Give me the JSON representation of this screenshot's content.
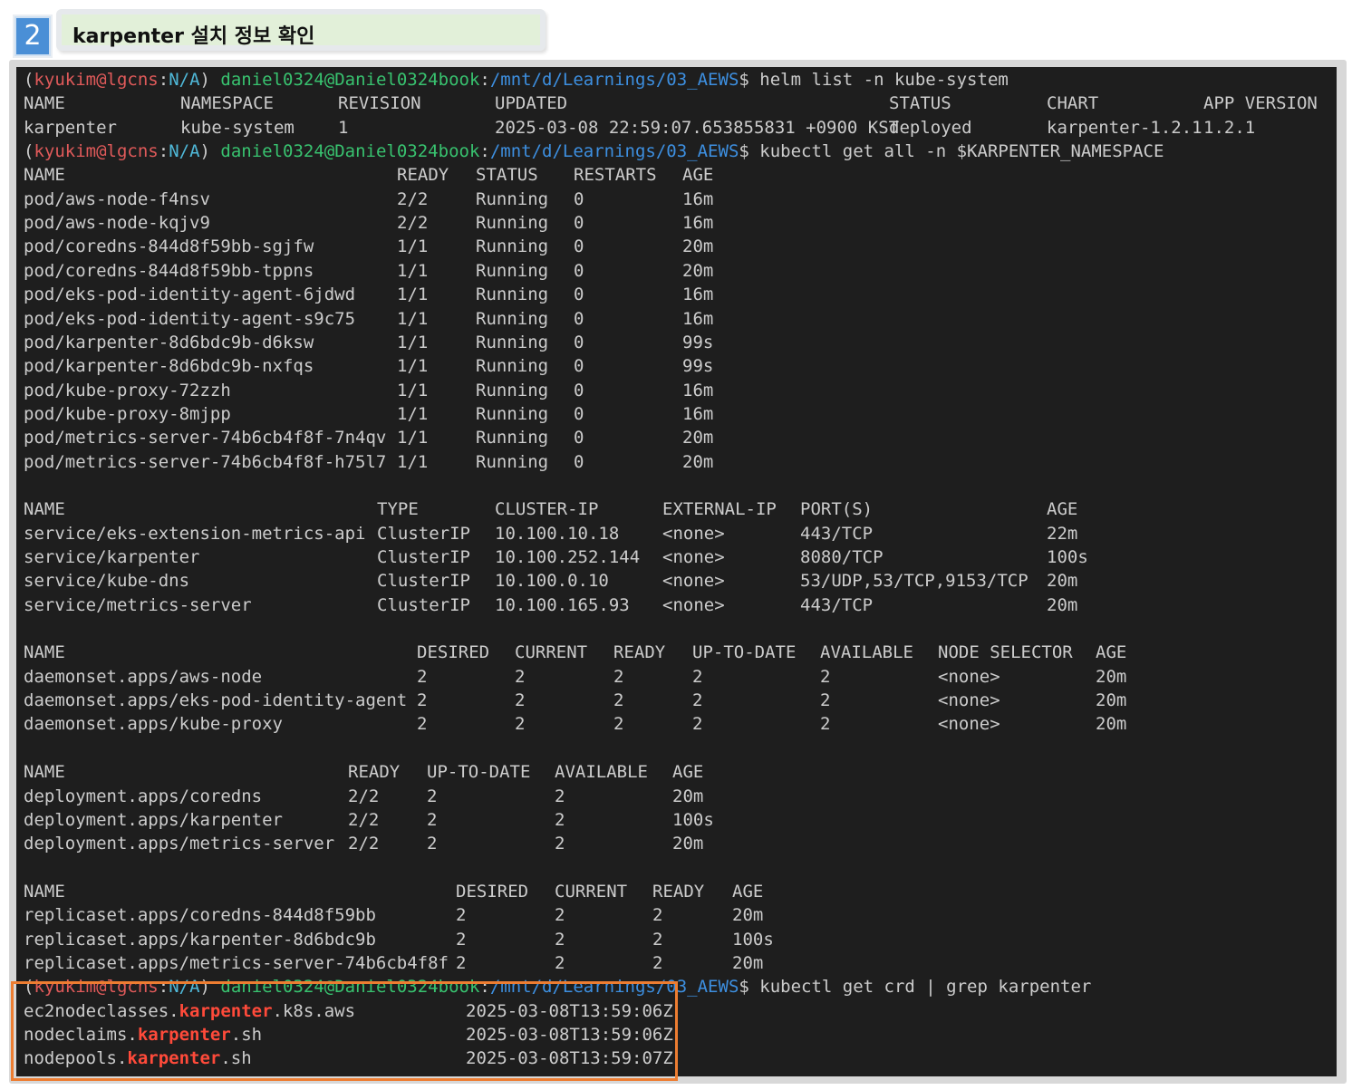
{
  "header": {
    "step_number": "2",
    "title": "karpenter 설치 정보 확인"
  },
  "prompt": {
    "open": "(",
    "user": "kyukim@lgcns",
    "sep": ":",
    "ctx": "N/A",
    "close": ") ",
    "host": "daniel0324@Daniel0324book",
    "colon": ":",
    "path": "/mnt/d/Learnings/03_AEWS",
    "dollar": "$ "
  },
  "commands": {
    "helm": "helm list -n kube-system",
    "kubectl_all": "kubectl get all -n $KARPENTER_NAMESPACE",
    "crd": "kubectl get crd | grep karpenter"
  },
  "helm_table": {
    "headers": [
      "NAME",
      "NAMESPACE",
      "REVISION",
      "UPDATED",
      "STATUS",
      "CHART",
      "APP VERSION"
    ],
    "rows": [
      [
        "karpenter",
        "kube-system",
        "1",
        "2025-03-08 22:59:07.653855831 +0900 KST",
        "deployed",
        "karpenter-1.2.1",
        "1.2.1"
      ]
    ]
  },
  "pods_table": {
    "headers": [
      "NAME",
      "READY",
      "STATUS",
      "RESTARTS",
      "AGE"
    ],
    "rows": [
      [
        "pod/aws-node-f4nsv",
        "2/2",
        "Running",
        "0",
        "16m"
      ],
      [
        "pod/aws-node-kqjv9",
        "2/2",
        "Running",
        "0",
        "16m"
      ],
      [
        "pod/coredns-844d8f59bb-sgjfw",
        "1/1",
        "Running",
        "0",
        "20m"
      ],
      [
        "pod/coredns-844d8f59bb-tppns",
        "1/1",
        "Running",
        "0",
        "20m"
      ],
      [
        "pod/eks-pod-identity-agent-6jdwd",
        "1/1",
        "Running",
        "0",
        "16m"
      ],
      [
        "pod/eks-pod-identity-agent-s9c75",
        "1/1",
        "Running",
        "0",
        "16m"
      ],
      [
        "pod/karpenter-8d6bdc9b-d6ksw",
        "1/1",
        "Running",
        "0",
        "99s"
      ],
      [
        "pod/karpenter-8d6bdc9b-nxfqs",
        "1/1",
        "Running",
        "0",
        "99s"
      ],
      [
        "pod/kube-proxy-72zzh",
        "1/1",
        "Running",
        "0",
        "16m"
      ],
      [
        "pod/kube-proxy-8mjpp",
        "1/1",
        "Running",
        "0",
        "16m"
      ],
      [
        "pod/metrics-server-74b6cb4f8f-7n4qv",
        "1/1",
        "Running",
        "0",
        "20m"
      ],
      [
        "pod/metrics-server-74b6cb4f8f-h75l7",
        "1/1",
        "Running",
        "0",
        "20m"
      ]
    ]
  },
  "services_table": {
    "headers": [
      "NAME",
      "TYPE",
      "CLUSTER-IP",
      "EXTERNAL-IP",
      "PORT(S)",
      "AGE"
    ],
    "rows": [
      [
        "service/eks-extension-metrics-api",
        "ClusterIP",
        "10.100.10.18",
        "<none>",
        "443/TCP",
        "22m"
      ],
      [
        "service/karpenter",
        "ClusterIP",
        "10.100.252.144",
        "<none>",
        "8080/TCP",
        "100s"
      ],
      [
        "service/kube-dns",
        "ClusterIP",
        "10.100.0.10",
        "<none>",
        "53/UDP,53/TCP,9153/TCP",
        "20m"
      ],
      [
        "service/metrics-server",
        "ClusterIP",
        "10.100.165.93",
        "<none>",
        "443/TCP",
        "20m"
      ]
    ]
  },
  "daemonsets_table": {
    "headers": [
      "NAME",
      "DESIRED",
      "CURRENT",
      "READY",
      "UP-TO-DATE",
      "AVAILABLE",
      "NODE SELECTOR",
      "AGE"
    ],
    "rows": [
      [
        "daemonset.apps/aws-node",
        "2",
        "2",
        "2",
        "2",
        "2",
        "<none>",
        "20m"
      ],
      [
        "daemonset.apps/eks-pod-identity-agent",
        "2",
        "2",
        "2",
        "2",
        "2",
        "<none>",
        "20m"
      ],
      [
        "daemonset.apps/kube-proxy",
        "2",
        "2",
        "2",
        "2",
        "2",
        "<none>",
        "20m"
      ]
    ]
  },
  "deployments_table": {
    "headers": [
      "NAME",
      "READY",
      "UP-TO-DATE",
      "AVAILABLE",
      "AGE"
    ],
    "rows": [
      [
        "deployment.apps/coredns",
        "2/2",
        "2",
        "2",
        "20m"
      ],
      [
        "deployment.apps/karpenter",
        "2/2",
        "2",
        "2",
        "100s"
      ],
      [
        "deployment.apps/metrics-server",
        "2/2",
        "2",
        "2",
        "20m"
      ]
    ]
  },
  "replicasets_table": {
    "headers": [
      "NAME",
      "DESIRED",
      "CURRENT",
      "READY",
      "AGE"
    ],
    "rows": [
      [
        "replicaset.apps/coredns-844d8f59bb",
        "2",
        "2",
        "2",
        "20m"
      ],
      [
        "replicaset.apps/karpenter-8d6bdc9b",
        "2",
        "2",
        "2",
        "100s"
      ],
      [
        "replicaset.apps/metrics-server-74b6cb4f8f",
        "2",
        "2",
        "2",
        "20m"
      ]
    ]
  },
  "crd_rows": [
    {
      "prefix": "ec2nodeclasses.",
      "match": "karpenter",
      "suffix": ".k8s.aws",
      "created": "2025-03-08T13:59:06Z"
    },
    {
      "prefix": "nodeclaims.",
      "match": "karpenter",
      "suffix": ".sh",
      "created": "2025-03-08T13:59:06Z"
    },
    {
      "prefix": "nodepools.",
      "match": "karpenter",
      "suffix": ".sh",
      "created": "2025-03-08T13:59:07Z"
    }
  ],
  "colors": {
    "terminal_bg": "#1e1e1e",
    "terminal_text": "#cccccc",
    "prompt_user": "#e05a5a",
    "prompt_ctx": "#4fb8d8",
    "prompt_host": "#38c26f",
    "prompt_path": "#3d8fe0",
    "grep_match": "#ff4a3a",
    "highlight_border": "#ed7d31",
    "title_bg": "#e2f0d9",
    "badge_bg": "#4a8fd6"
  }
}
